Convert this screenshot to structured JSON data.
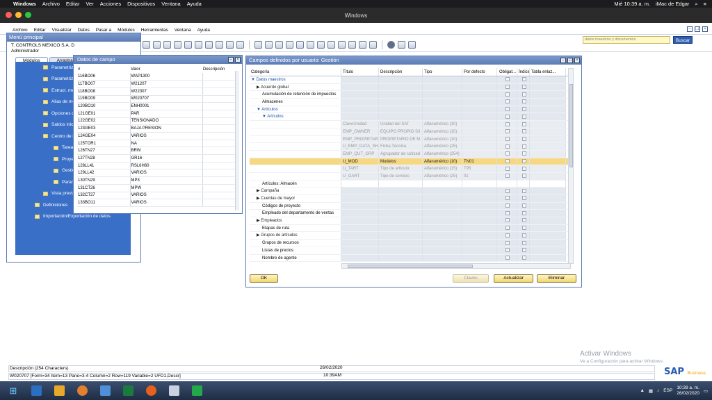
{
  "mac": {
    "apple": "",
    "app_name": "Windows",
    "menu": [
      "Archivo",
      "Editar",
      "Ver",
      "Acciones",
      "Dispositivos",
      "Ventana",
      "Ayuda"
    ],
    "datetime": "Mié 10:39 a. m.",
    "user": "iMac de Edgar"
  },
  "window_title": "Windows",
  "sap_menu": [
    "Archivo",
    "Editar",
    "Visualizar",
    "Datos",
    "Pasar a",
    "Módulos",
    "Herramientas",
    "Ventana",
    "Ayuda"
  ],
  "search": {
    "placeholder": "datos maestros y documentos",
    "button": "Buscar"
  },
  "menu_principal": {
    "title": "Menú principal",
    "company": "T. CONTROLS MEXICO S.A. D",
    "user": "Administrador",
    "tabs": [
      "Módulos",
      "Arrastrar y re"
    ],
    "nodes": [
      "Parametriza",
      "Parametriza",
      "Estruct. men",
      "Alias de me",
      "Opciones de",
      "Saldos inici",
      "Centro de in",
      "Tareas d",
      "Proyecto",
      "Gestión",
      "Paramet",
      "Vista previa de texto de quick info",
      "Definiciones",
      "Importación/Exportación de datos"
    ]
  },
  "datos_campo": {
    "title": "Datos de campo",
    "columns": [
      "#",
      "Valor",
      "Descripción"
    ],
    "rows": [
      [
        "116",
        "BO06",
        "WAP1300"
      ],
      [
        "117",
        "BO07",
        "W21207"
      ],
      [
        "118",
        "BO08",
        "W22307"
      ],
      [
        "119",
        "BO09",
        "W020707"
      ],
      [
        "120",
        "BO10",
        "ENH0001"
      ],
      [
        "121",
        "GE01",
        "PAR"
      ],
      [
        "122",
        "GE02",
        "TENSIONADO"
      ],
      [
        "123",
        "GE03",
        "BAJA PRESION"
      ],
      [
        "124",
        "GE04",
        "VARIOS"
      ],
      [
        "125",
        "TOR1",
        "NA"
      ],
      [
        "126",
        "TN27",
        "BRW"
      ],
      [
        "127",
        "TN28",
        "GR16"
      ],
      [
        "128",
        "LL41",
        "RSL6H60"
      ],
      [
        "129",
        "LL42",
        "VARIOS"
      ],
      [
        "130",
        "TN29",
        "MP3"
      ],
      [
        "131",
        "CT26",
        "MPW"
      ],
      [
        "132",
        "CT27",
        "VARIOS"
      ],
      [
        "133",
        "BO11",
        "VARIOS"
      ]
    ]
  },
  "campos": {
    "title": "Campos definidos por usuario: Gestión",
    "columns": [
      "Categoría",
      "Título",
      "Descripción",
      "Tipo",
      "Por defecto",
      "Obligat...",
      "Índice",
      "Tabla enlaz..."
    ],
    "rows": [
      {
        "c0": "▼ Datos maestros",
        "lvl": 0,
        "kind": "cat"
      },
      {
        "c0": "▶ Acuerdo global",
        "lvl": 1,
        "kind": "cat"
      },
      {
        "c0": "Acumulación de retención de impuestos",
        "lvl": 2,
        "kind": "cat"
      },
      {
        "c0": "Almacenes",
        "lvl": 2,
        "kind": "cat"
      },
      {
        "c0": "▼ Artículos",
        "lvl": 1,
        "kind": "cat"
      },
      {
        "c0": "▼ Artículos",
        "lvl": 2,
        "kind": "cat"
      },
      {
        "c0": "",
        "c1": "ClaveUnidad",
        "c2": "Unidad del SAT",
        "c3": "Alfanumérico (10)",
        "c4": "",
        "kind": "grey"
      },
      {
        "c0": "",
        "c1": "EMP_OWNER",
        "c2": "EQUIPO PROPIO S/I",
        "c3": "Alfanumérico (10)",
        "c4": "",
        "kind": "grey"
      },
      {
        "c0": "",
        "c1": "EMP_PROPIETAR",
        "c2": "PROPIETARIO DE M",
        "c3": "Alfanumérico (10)",
        "c4": "",
        "kind": "grey"
      },
      {
        "c0": "",
        "c1": "U_EMP_DATA_SH",
        "c2": "Ficha Técnica",
        "c3": "Alfanumérico (25)",
        "c4": "",
        "kind": "grey"
      },
      {
        "c0": "",
        "c1": "EMP_QUT_GRP",
        "c2": "Agrupador de cotizad",
        "c3": "Alfanumérico (254)",
        "c4": "",
        "kind": "grey"
      },
      {
        "c0": "",
        "c1": "U_MOD",
        "c2": "Modelos",
        "c3": "Alfanumérico (10)",
        "c4": "TN01",
        "kind": "sel"
      },
      {
        "c0": "",
        "c1": "U_TART",
        "c2": "Tipo de artículo",
        "c3": "Alfanumérico (15)",
        "c4": "T95",
        "kind": "grey"
      },
      {
        "c0": "",
        "c1": "U_OART",
        "c2": "Tipo de servicio",
        "c3": "Alfanumérico (25)",
        "c4": "01",
        "kind": "grey"
      },
      {
        "c0": "Artículos: Almacén",
        "lvl": 2,
        "kind": "plain"
      },
      {
        "c0": "▶ Campaña",
        "lvl": 1,
        "kind": "cat"
      },
      {
        "c0": "▶ Cuentas de mayor",
        "lvl": 1,
        "kind": "cat"
      },
      {
        "c0": "Códigos de proyecto",
        "lvl": 2,
        "kind": "cat"
      },
      {
        "c0": "Empleado del departamento de ventas",
        "lvl": 2,
        "kind": "cat"
      },
      {
        "c0": "▶ Empleados",
        "lvl": 1,
        "kind": "cat"
      },
      {
        "c0": "Etapas de ruta",
        "lvl": 2,
        "kind": "cat"
      },
      {
        "c0": "▶ Grupos de artículos",
        "lvl": 1,
        "kind": "cat"
      },
      {
        "c0": "Grupos de recursos",
        "lvl": 2,
        "kind": "cat"
      },
      {
        "c0": "Listas de precios",
        "lvl": 2,
        "kind": "cat"
      },
      {
        "c0": "Nombre de agente",
        "lvl": 2,
        "kind": "cat"
      }
    ],
    "buttons": {
      "ok": "OK",
      "claves": "Claves",
      "actualizar": "Actualizar",
      "eliminar": "Eliminar"
    }
  },
  "status": {
    "line1": "Descripción (254 Characters)",
    "line2": "W020707 [Form=34 Item=13 Pane=3-4 Column=2 Row=119 Variable=2 UFD1,Descr]",
    "date": "26/02/2020",
    "time": "10:39AM"
  },
  "watermark": {
    "title": "Activar Windows",
    "subtitle": "Ve a Configuración para activar Windows."
  },
  "sap_logo": {
    "brand": "SAP",
    "product": "Business One"
  },
  "tray": {
    "lang": "ESP",
    "time": "10:39 a. m.",
    "date": "26/02/2020"
  },
  "colors": {
    "sap_blue": "#3a6fc7",
    "selected_row": "#f7d882",
    "title_bar": "#5b7bb5"
  }
}
